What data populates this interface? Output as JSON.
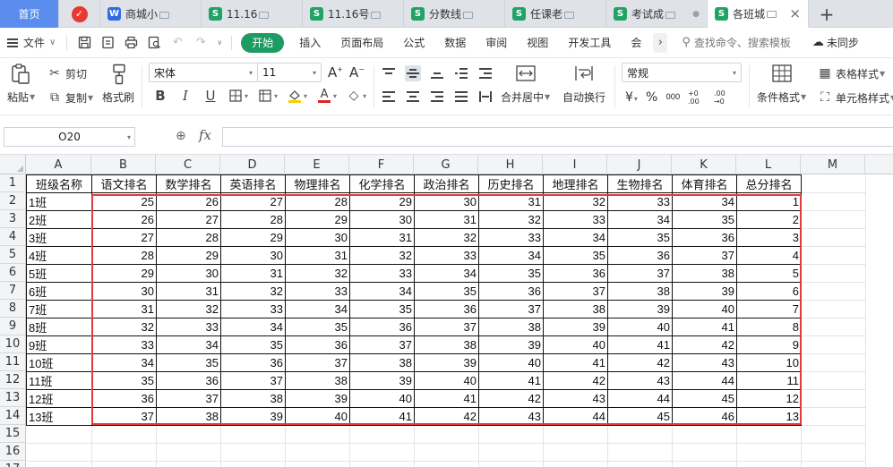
{
  "tabs": {
    "home": "首页",
    "docs": [
      {
        "label": "商城小",
        "type": "W",
        "active": false
      },
      {
        "label": "11.16",
        "type": "S",
        "active": false
      },
      {
        "label": "11.16号",
        "type": "S",
        "active": false
      },
      {
        "label": "分数线",
        "type": "S",
        "active": false
      },
      {
        "label": "任课老",
        "type": "S",
        "active": false
      },
      {
        "label": "考试成",
        "type": "S",
        "active": false
      },
      {
        "label": "各班城",
        "type": "S",
        "active": true
      }
    ],
    "add": "+"
  },
  "menubar": {
    "file": "文件",
    "tabs": [
      "开始",
      "插入",
      "页面布局",
      "公式",
      "数据",
      "审阅",
      "视图",
      "开发工具",
      "会"
    ],
    "active_tab": "开始",
    "search": "查找命令、搜索模板",
    "sync": "未同步"
  },
  "ribbon": {
    "paste": "粘贴",
    "cut": "剪切",
    "copy": "复制",
    "format_painter": "格式刷",
    "font_name": "宋体",
    "font_size": "11",
    "merge_center": "合并居中",
    "wrap_text": "自动换行",
    "number_format": "常规",
    "conditional_format": "条件格式",
    "table_style": "表格样式",
    "cell_style": "单元格样式",
    "currency": "¥",
    "percent": "%",
    "thousands": "000",
    "dec_inc": "+0 .00",
    "dec_dec": ".00 →0"
  },
  "formula_bar": {
    "name_box": "O20",
    "fx": "fx",
    "formula": ""
  },
  "sheet": {
    "columns": [
      "A",
      "B",
      "C",
      "D",
      "E",
      "F",
      "G",
      "H",
      "I",
      "J",
      "K",
      "L",
      "M"
    ],
    "rows": [
      "1",
      "2",
      "3",
      "4",
      "5",
      "6",
      "7",
      "8",
      "9",
      "10",
      "11",
      "12",
      "13",
      "14",
      "15",
      "16",
      "17"
    ],
    "header": [
      "班级名称",
      "语文排名",
      "数学排名",
      "英语排名",
      "物理排名",
      "化学排名",
      "政治排名",
      "历史排名",
      "地理排名",
      "生物排名",
      "体育排名",
      "总分排名"
    ],
    "data": [
      [
        "1班",
        25,
        26,
        27,
        28,
        29,
        30,
        31,
        32,
        33,
        34,
        1
      ],
      [
        "2班",
        26,
        27,
        28,
        29,
        30,
        31,
        32,
        33,
        34,
        35,
        2
      ],
      [
        "3班",
        27,
        28,
        29,
        30,
        31,
        32,
        33,
        34,
        35,
        36,
        3
      ],
      [
        "4班",
        28,
        29,
        30,
        31,
        32,
        33,
        34,
        35,
        36,
        37,
        4
      ],
      [
        "5班",
        29,
        30,
        31,
        32,
        33,
        34,
        35,
        36,
        37,
        38,
        5
      ],
      [
        "6班",
        30,
        31,
        32,
        33,
        34,
        35,
        36,
        37,
        38,
        39,
        6
      ],
      [
        "7班",
        31,
        32,
        33,
        34,
        35,
        36,
        37,
        38,
        39,
        40,
        7
      ],
      [
        "8班",
        32,
        33,
        34,
        35,
        36,
        37,
        38,
        39,
        40,
        41,
        8
      ],
      [
        "9班",
        33,
        34,
        35,
        36,
        37,
        38,
        39,
        40,
        41,
        42,
        9
      ],
      [
        "10班",
        34,
        35,
        36,
        37,
        38,
        39,
        40,
        41,
        42,
        43,
        10
      ],
      [
        "11班",
        35,
        36,
        37,
        38,
        39,
        40,
        41,
        42,
        43,
        44,
        11
      ],
      [
        "12班",
        36,
        37,
        38,
        39,
        40,
        41,
        42,
        43,
        44,
        45,
        12
      ],
      [
        "13班",
        37,
        38,
        39,
        40,
        41,
        42,
        43,
        44,
        45,
        46,
        13
      ]
    ]
  },
  "colors": {
    "accent_green": "#1e9a63",
    "home_tab_blue": "#5b8def",
    "highlight_red": "#e23b3b"
  }
}
